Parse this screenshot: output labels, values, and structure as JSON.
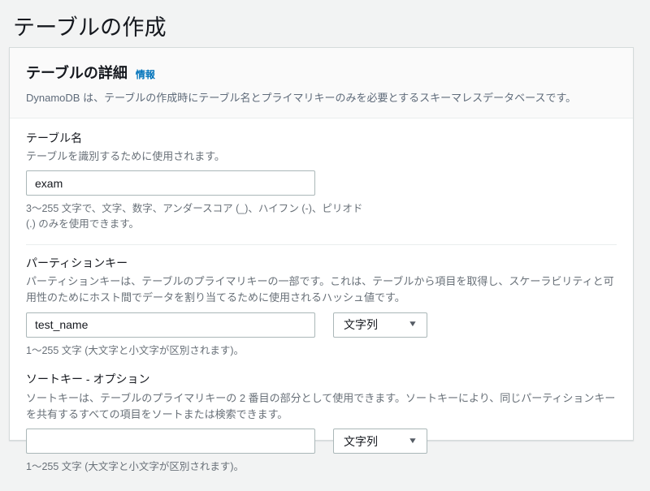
{
  "page": {
    "title": "テーブルの作成"
  },
  "panel": {
    "title": "テーブルの詳細",
    "info_link": "情報",
    "description": "DynamoDB は、テーブルの作成時にテーブル名とプライマリキーのみを必要とするスキーマレスデータベースです。"
  },
  "table_name": {
    "label": "テーブル名",
    "description": "テーブルを識別するために使用されます。",
    "value": "exam",
    "constraint": "3～255 文字で、文字、数字、アンダースコア (_)、ハイフン (-)、ピリオド (.) のみを使用できます。"
  },
  "partition_key": {
    "label": "パーティションキー",
    "description": "パーティションキーは、テーブルのプライマリキーの一部です。これは、テーブルから項目を取得し、スケーラビリティと可用性のためにホスト間でデータを割り当てるために使用されるハッシュ値です。",
    "value": "test_name",
    "type_selected": "文字列",
    "caret": "▼",
    "constraint": "1～255 文字 (大文字と小文字が区別されます)。"
  },
  "sort_key": {
    "label": "ソートキー - オプション",
    "description": "ソートキーは、テーブルのプライマリキーの 2 番目の部分として使用できます。ソートキーにより、同じパーティションキーを共有するすべての項目をソートまたは検索できます。",
    "value": "",
    "type_selected": "文字列",
    "caret": "▼",
    "constraint": "1～255 文字 (大文字と小文字が区別されます)。"
  },
  "colors": {
    "page_background": "#f2f3f3",
    "panel_background": "#ffffff",
    "panel_header_background": "#fafafa",
    "panel_border": "#d5dbdb",
    "input_border": "#aab7b8",
    "link_blue": "#0073bb",
    "text_primary": "#16191f",
    "text_secondary": "#687078"
  }
}
